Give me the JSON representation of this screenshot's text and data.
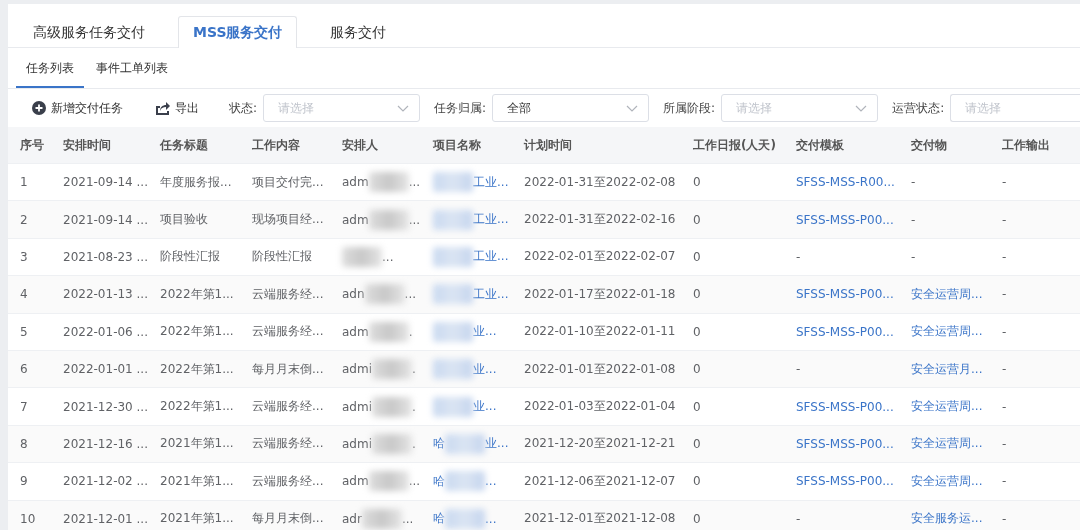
{
  "tabs": [
    {
      "label": "高级服务任务交付",
      "selected": false
    },
    {
      "label": "MSS服务交付",
      "selected": true
    },
    {
      "label": "服务交付",
      "selected": false
    }
  ],
  "subtabs": [
    {
      "label": "任务列表",
      "selected": true
    },
    {
      "label": "事件工单列表",
      "selected": false
    }
  ],
  "toolbar": {
    "actions": [
      {
        "kind": "add",
        "label": "新增交付任务"
      },
      {
        "kind": "export",
        "label": "导出"
      }
    ],
    "filters": [
      {
        "label": "状态:",
        "placeholder": "请选择",
        "chevron": true
      },
      {
        "label": "任务归属:",
        "value": "全部",
        "chevron": true
      },
      {
        "label": "所属阶段:",
        "placeholder": "请选择",
        "chevron": true
      },
      {
        "label": "运营状态:",
        "placeholder": "请选择",
        "chevron": false
      }
    ]
  },
  "table": {
    "columns": [
      "序号",
      "安排时间",
      "任务标题",
      "工作内容",
      "安排人",
      "项目名称",
      "计划时间",
      "工作日报(人天)",
      "交付模板",
      "交付物",
      "工作输出"
    ],
    "rows": [
      {
        "no": "1",
        "time": "2021-09-14 ...",
        "title": "年度服务报...",
        "content": "项目交付完...",
        "arranger": {
          "before": "adm",
          "after": "..."
        },
        "project": {
          "after": "工业..."
        },
        "plan": "2022-01-31至2022-02-08",
        "daily": "0",
        "template": {
          "text": "SFSS-MSS-R00...",
          "link": true
        },
        "deliverable": {
          "text": "-",
          "link": false
        },
        "output": "-"
      },
      {
        "no": "2",
        "time": "2021-09-14 ...",
        "title": "项目验收",
        "content": "现场项目经...",
        "arranger": {
          "before": "adm",
          "after": "..."
        },
        "project": {
          "after": "工业..."
        },
        "plan": "2022-01-31至2022-02-16",
        "daily": "0",
        "template": {
          "text": "SFSS-MSS-P00...",
          "link": true
        },
        "deliverable": {
          "text": "-",
          "link": false
        },
        "output": "-"
      },
      {
        "no": "3",
        "time": "2021-08-23 ...",
        "title": "阶段性汇报",
        "content": "阶段性汇报",
        "arranger": {
          "after": "..."
        },
        "project": {
          "after": "工业..."
        },
        "plan": "2022-02-01至2022-02-07",
        "daily": "0",
        "template": {
          "text": "-",
          "link": false
        },
        "deliverable": {
          "text": "-",
          "link": false
        },
        "output": "-"
      },
      {
        "no": "4",
        "time": "2022-01-13 ...",
        "title": "2022年第1...",
        "content": "云端服务经...",
        "arranger": {
          "before": "adn",
          "after": "..."
        },
        "project": {
          "after": "工业..."
        },
        "plan": "2022-01-17至2022-01-18",
        "daily": "0",
        "template": {
          "text": "SFSS-MSS-P00...",
          "link": true
        },
        "deliverable": {
          "text": "安全运营周...",
          "link": true
        },
        "output": "-"
      },
      {
        "no": "5",
        "time": "2022-01-06 ...",
        "title": "2022年第1...",
        "content": "云端服务经...",
        "arranger": {
          "before": "adm",
          "after": "."
        },
        "project": {
          "after": "业..."
        },
        "plan": "2022-01-10至2022-01-11",
        "daily": "0",
        "template": {
          "text": "SFSS-MSS-P00...",
          "link": true
        },
        "deliverable": {
          "text": "安全运营周...",
          "link": true
        },
        "output": "-"
      },
      {
        "no": "6",
        "time": "2022-01-01 ...",
        "title": "2022年第1...",
        "content": "每月月末倒...",
        "arranger": {
          "before": "admi",
          "after": "."
        },
        "project": {
          "after": "业..."
        },
        "plan": "2022-01-01至2022-01-08",
        "daily": "0",
        "template": {
          "text": "-",
          "link": false
        },
        "deliverable": {
          "text": "安全运营月...",
          "link": true
        },
        "output": "-"
      },
      {
        "no": "7",
        "time": "2021-12-30 ...",
        "title": "2022年第1...",
        "content": "云端服务经...",
        "arranger": {
          "before": "admi",
          "after": "."
        },
        "project": {
          "after": "业..."
        },
        "plan": "2022-01-03至2022-01-04",
        "daily": "0",
        "template": {
          "text": "SFSS-MSS-P00...",
          "link": true
        },
        "deliverable": {
          "text": "安全运营周...",
          "link": true
        },
        "output": "-"
      },
      {
        "no": "8",
        "time": "2021-12-16 ...",
        "title": "2021年第1...",
        "content": "云端服务经...",
        "arranger": {
          "before": "admi",
          "after": "."
        },
        "project": {
          "before": "哈",
          "after": "业..."
        },
        "plan": "2021-12-20至2021-12-21",
        "daily": "0",
        "template": {
          "text": "SFSS-MSS-P00...",
          "link": true
        },
        "deliverable": {
          "text": "安全运营周...",
          "link": true
        },
        "output": "-"
      },
      {
        "no": "9",
        "time": "2021-12-02 ...",
        "title": "2021年第1...",
        "content": "云端服务经...",
        "arranger": {
          "before": "adm",
          "after": "..."
        },
        "project": {
          "before": "哈",
          "after": "..."
        },
        "plan": "2021-12-06至2021-12-07",
        "daily": "0",
        "template": {
          "text": "SFSS-MSS-P00...",
          "link": true
        },
        "deliverable": {
          "text": "安全运营周...",
          "link": true
        },
        "output": "-"
      },
      {
        "no": "10",
        "time": "2021-12-01 ...",
        "title": "2021年第1...",
        "content": "每月月末倒...",
        "arranger": {
          "before": "adr",
          "after": "..."
        },
        "project": {
          "before": "哈",
          "after": "..."
        },
        "plan": "2021-12-01至2021-12-08",
        "daily": "0",
        "template": {
          "text": "-",
          "link": false
        },
        "deliverable": {
          "text": "安全服务运...",
          "link": true
        },
        "output": "-"
      }
    ]
  }
}
